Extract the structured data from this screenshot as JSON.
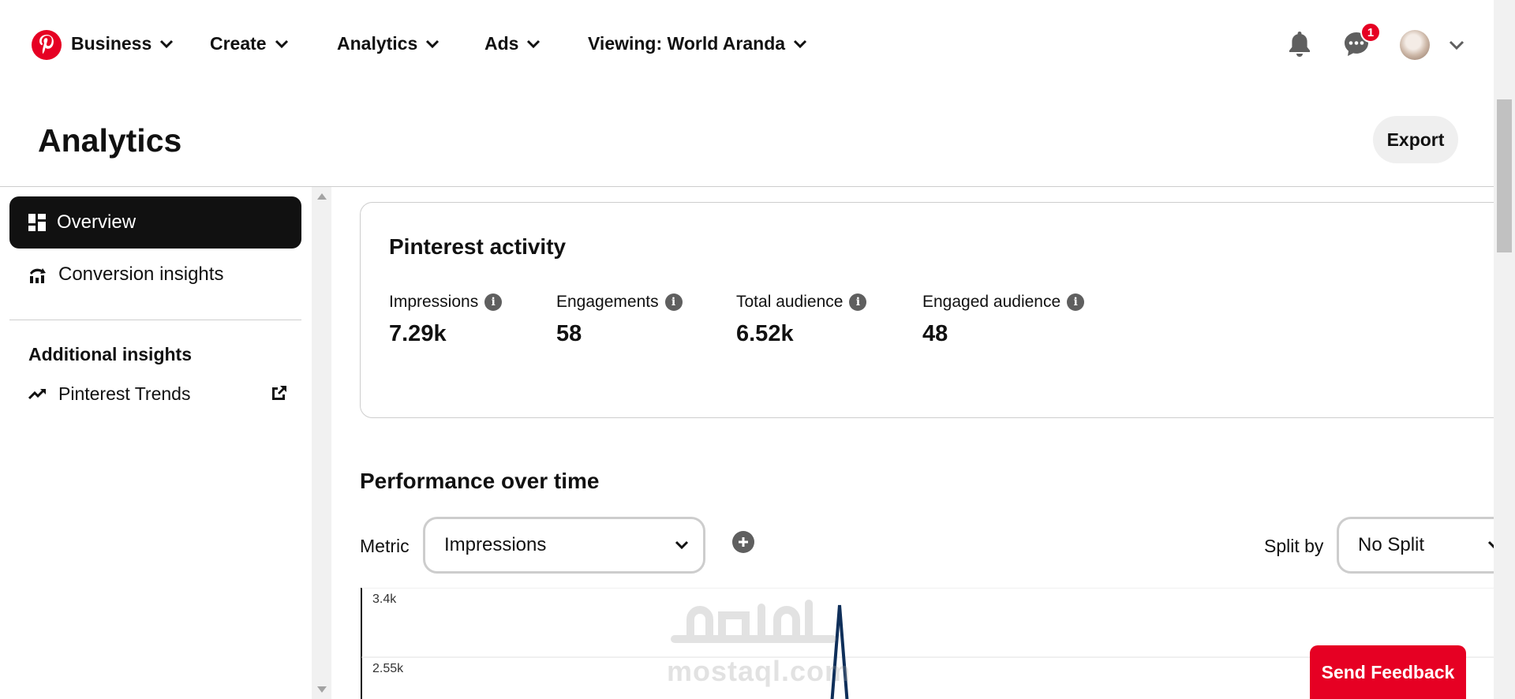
{
  "nav": {
    "business": "Business",
    "create": "Create",
    "analytics": "Analytics",
    "ads": "Ads",
    "viewing": "Viewing: World Aranda",
    "messages_badge": "1"
  },
  "header": {
    "title": "Analytics",
    "export_label": "Export"
  },
  "sidebar": {
    "items": [
      {
        "label": "Overview",
        "active": true,
        "icon": "dashboard-icon"
      },
      {
        "label": "Conversion insights",
        "active": false,
        "icon": "conversion-icon"
      }
    ],
    "additional_heading": "Additional insights",
    "trends_label": "Pinterest Trends"
  },
  "activity": {
    "title": "Pinterest activity",
    "stats": [
      {
        "label": "Impressions",
        "value": "7.29k"
      },
      {
        "label": "Engagements",
        "value": "58"
      },
      {
        "label": "Total audience",
        "value": "6.52k"
      },
      {
        "label": "Engaged audience",
        "value": "48"
      }
    ]
  },
  "performance": {
    "title": "Performance over time",
    "metric_label": "Metric",
    "metric_value": "Impressions",
    "split_label": "Split by",
    "split_value": "No Split"
  },
  "chart_data": {
    "type": "line",
    "title": "",
    "xlabel": "",
    "ylabel": "",
    "y_ticks": [
      "3.4k",
      "2.55k"
    ],
    "ylim": [
      0,
      3400
    ],
    "series": [
      {
        "values": [
          0,
          3400,
          0
        ]
      }
    ],
    "grid": true,
    "line_color": "#0f2f5a"
  },
  "feedback_label": "Send Feedback",
  "watermark": {
    "arabic": "مستقل",
    "latin": "mostaql.com"
  }
}
